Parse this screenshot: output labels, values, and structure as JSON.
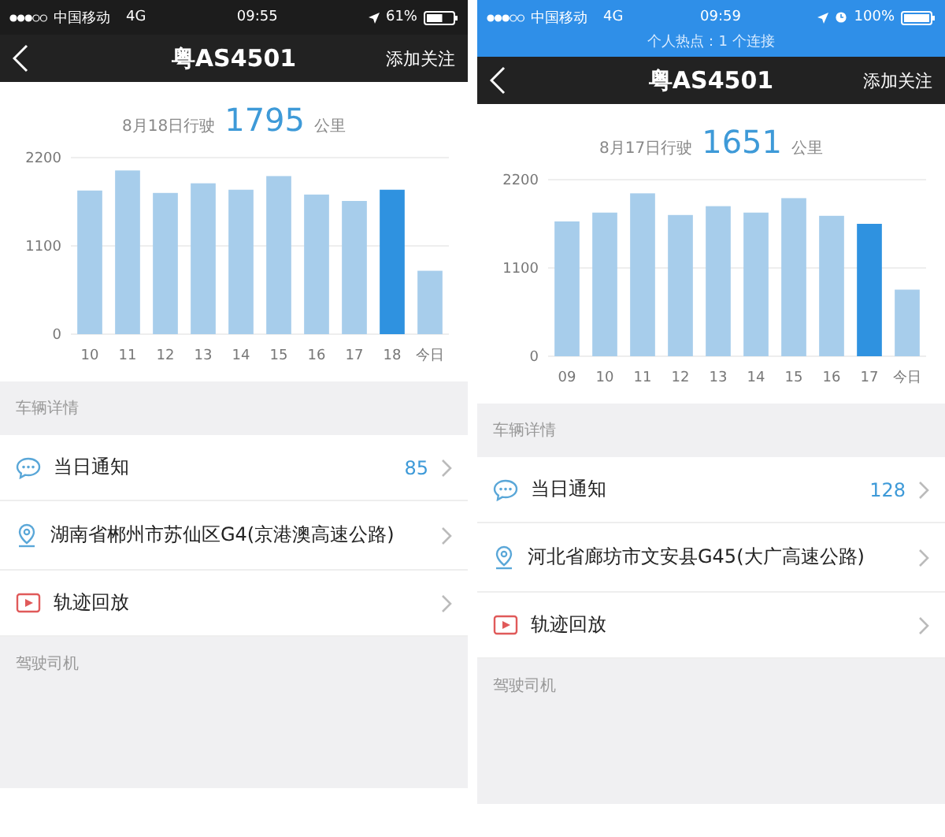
{
  "phones": [
    {
      "status_bar": {
        "carrier": "中国移动",
        "network": "4G",
        "time": "09:55",
        "battery": "61%",
        "alarm_icon": false
      },
      "nav": {
        "title": "粤AS4501",
        "action": "添加关注"
      },
      "summary": {
        "date_label": "8月18日行驶",
        "distance": "1795",
        "unit": "公里"
      },
      "chart_data": {
        "type": "bar",
        "categories": [
          "10",
          "11",
          "12",
          "13",
          "14",
          "15",
          "16",
          "17",
          "18",
          "今日"
        ],
        "yticks": [
          0,
          1100,
          2200
        ],
        "ylim": [
          0,
          2200
        ],
        "series": [
          {
            "color": "#a7cdeb",
            "values": [
              1790,
              2040,
              1760,
              1880,
              1800,
              1970,
              1740,
              1660,
              null,
              790
            ]
          },
          {
            "color": "#2f92e0",
            "values": [
              null,
              null,
              null,
              null,
              null,
              null,
              null,
              null,
              1800,
              null
            ]
          }
        ]
      },
      "vehicle_details": {
        "header": "车辆详情",
        "rows": [
          {
            "kind": "notification",
            "label": "当日通知",
            "count": "85"
          },
          {
            "kind": "location",
            "label": "湖南省郴州市苏仙区G4(京港澳高速公路)"
          },
          {
            "kind": "playback",
            "label": "轨迹回放"
          }
        ]
      },
      "driver_section": {
        "header": "驾驶司机"
      }
    },
    {
      "status_bar": {
        "carrier": "中国移动",
        "network": "4G",
        "time": "09:59",
        "battery": "100%",
        "alarm_icon": true,
        "hotspot": "个人热点：1 个连接"
      },
      "nav": {
        "title": "粤AS4501",
        "action": "添加关注"
      },
      "summary": {
        "date_label": "8月17日行驶",
        "distance": "1651",
        "unit": "公里"
      },
      "chart_data": {
        "type": "bar",
        "categories": [
          "09",
          "10",
          "11",
          "12",
          "13",
          "14",
          "15",
          "16",
          "17",
          "今日"
        ],
        "yticks": [
          0,
          1100,
          2200
        ],
        "ylim": [
          0,
          2200
        ],
        "series": [
          {
            "color": "#a7cdeb",
            "values": [
              1680,
              1790,
              2030,
              1760,
              1870,
              1790,
              1970,
              1750,
              null,
              830
            ]
          },
          {
            "color": "#2f92e0",
            "values": [
              null,
              null,
              null,
              null,
              null,
              null,
              null,
              null,
              1650,
              null
            ]
          }
        ]
      },
      "vehicle_details": {
        "header": "车辆详情",
        "rows": [
          {
            "kind": "notification",
            "label": "当日通知",
            "count": "128"
          },
          {
            "kind": "location",
            "label": "河北省廊坊市文安县G45(大广高速公路)"
          },
          {
            "kind": "playback",
            "label": "轨迹回放"
          }
        ]
      },
      "driver_section": {
        "header": "驾驶司机"
      }
    }
  ]
}
